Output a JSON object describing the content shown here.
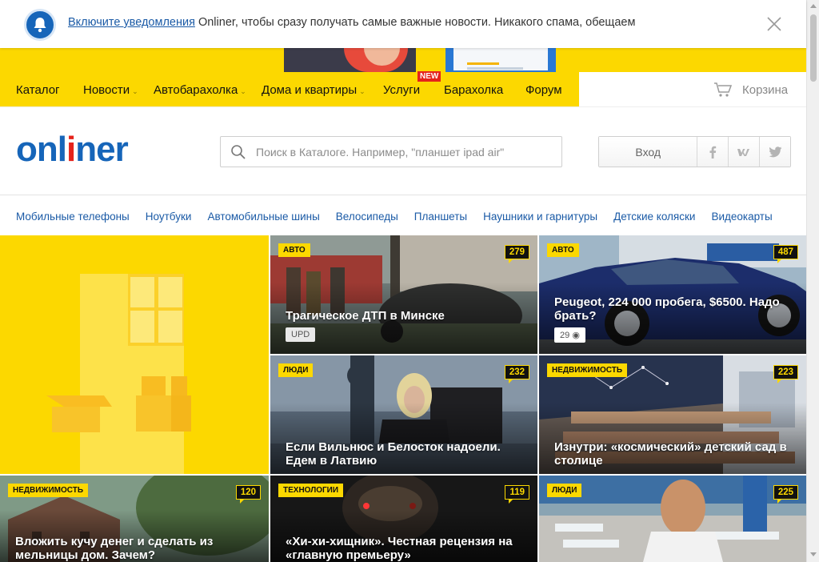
{
  "notification": {
    "link_text": "Включите уведомления",
    "message": " Onliner, чтобы сразу получать самые важные новости. Никакого спама, обещаем"
  },
  "nav": {
    "items": [
      {
        "label": "Каталог",
        "has_dropdown": false
      },
      {
        "label": "Новости",
        "has_dropdown": true
      },
      {
        "label": "Автобарахолка",
        "has_dropdown": true
      },
      {
        "label": "Дома и квартиры",
        "has_dropdown": true
      },
      {
        "label": "Услуги",
        "has_dropdown": false
      },
      {
        "label": "Барахолка",
        "has_dropdown": false
      },
      {
        "label": "Форум",
        "has_dropdown": false
      }
    ],
    "new_badge": "NEW",
    "cart_label": "Корзина"
  },
  "header": {
    "logo_part1": "onl",
    "logo_accent": "i",
    "logo_part2": "ner",
    "search_placeholder": "Поиск в Каталоге. Например, \"планшет ipad air\"",
    "login_label": "Вход",
    "social": [
      "f",
      "vk",
      "tw"
    ]
  },
  "categories": [
    "Мобильные телефоны",
    "Ноутбуки",
    "Автомобильные шины",
    "Велосипеды",
    "Планшеты",
    "Наушники и гарнитуры",
    "Детские коляски",
    "Видеокарты"
  ],
  "tiles": [
    {
      "tag": "Авто",
      "count": "279",
      "title": "Трагическое ДТП в Минске",
      "badge": "UPD"
    },
    {
      "tag": "Авто",
      "count": "487",
      "title": "Peugeot, 224 000 пробега, $6500. Надо брать?",
      "photos": "29"
    },
    {
      "tag": "Люди",
      "count": "232",
      "title": "Если Вильнюс и Белосток надоели. Едем в Латвию"
    },
    {
      "tag": "Недвижимость",
      "count": "223",
      "title": "Изнутри: «космический» детский сад в столице"
    },
    {
      "tag": "Недвижимость",
      "count": "120",
      "title": "Вложить кучу денег и сделать из мельницы дом. Зачем?"
    },
    {
      "tag": "Технологии",
      "count": "119",
      "title": "«Хи-хи-хищник». Честная рецензия на «главную премьеру»"
    },
    {
      "tag": "Люди",
      "count": "225",
      "title": ""
    }
  ],
  "colors": {
    "brand_blue": "#1665b9",
    "brand_red": "#e5231b",
    "accent_yellow": "#fcd800"
  }
}
